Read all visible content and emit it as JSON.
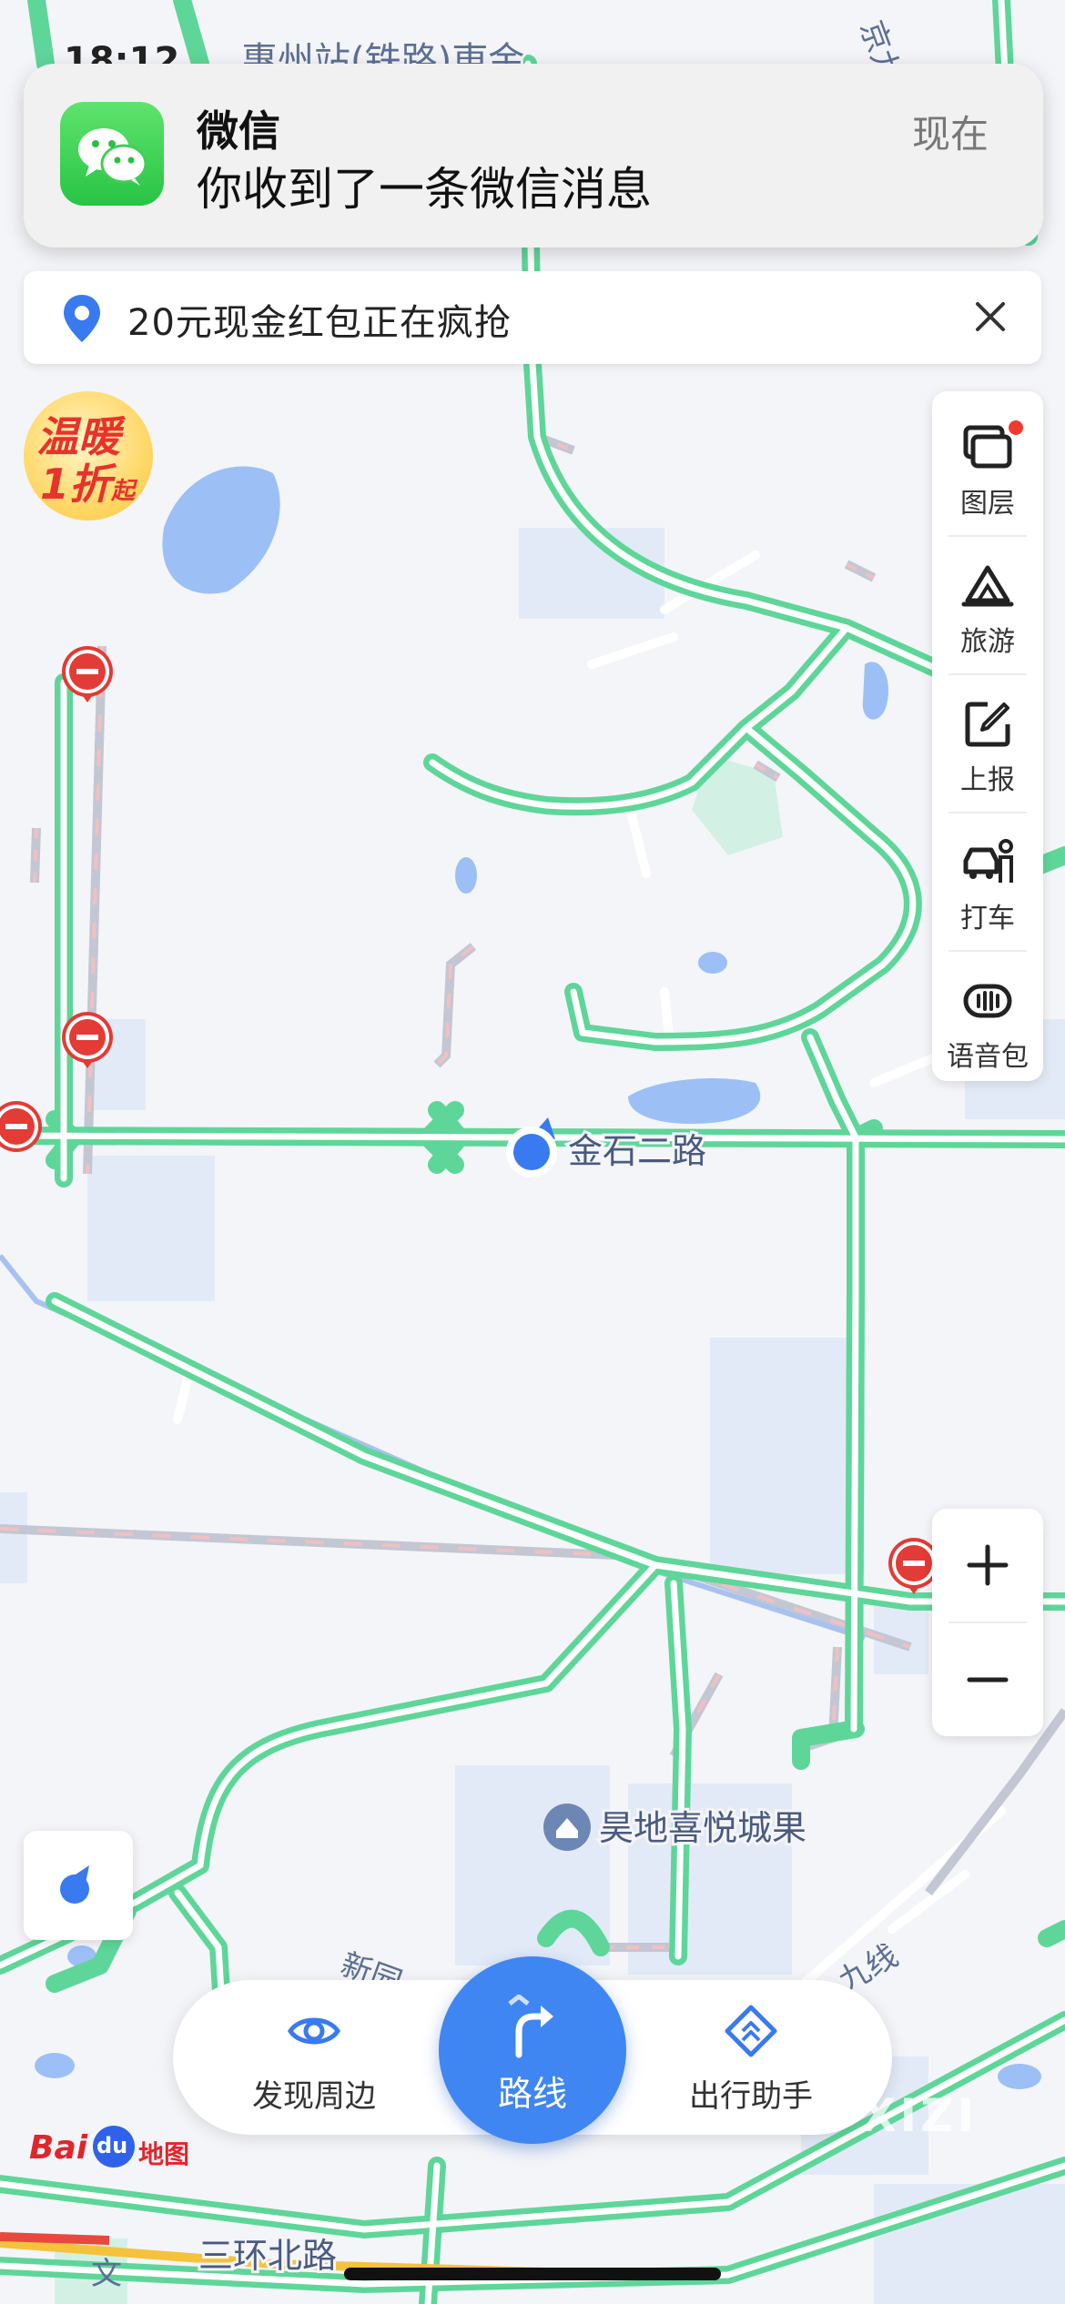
{
  "status_bar": {
    "time": "18:12"
  },
  "notification": {
    "app_name": "微信",
    "message": "你收到了一条微信消息",
    "time": "现在",
    "icon": "wechat-icon"
  },
  "promo_banner": {
    "text": "20元现金红包正在疯抢",
    "icon": "location-pin-icon",
    "close_icon": "close-icon"
  },
  "promo_badge": {
    "line1": "温暖",
    "line2": "1折",
    "suffix": "起"
  },
  "side_toolbar": {
    "items": [
      {
        "label": "图层",
        "icon": "layers-icon",
        "has_red_dot": true
      },
      {
        "label": "旅游",
        "icon": "travel-icon"
      },
      {
        "label": "上报",
        "icon": "report-icon"
      },
      {
        "label": "打车",
        "icon": "taxi-icon"
      },
      {
        "label": "语音包",
        "icon": "voice-pack-icon"
      }
    ]
  },
  "zoom": {
    "in_icon": "plus-icon",
    "out_icon": "minus-icon"
  },
  "map": {
    "labels": {
      "top_road": "惠州站(铁路)東金",
      "road_current": "金石二路",
      "poi_mall": "昊地喜悦城果",
      "road_bottom": "三环北路",
      "road_partial_left": "新园",
      "road_partial_right": "九线",
      "road_partial_corner": "文",
      "road_partial_top": "京九"
    },
    "colors": {
      "road_green": "#5ed699",
      "water_blue": "#9cc0f5",
      "block_blue": "#e3eaf7",
      "background": "#f4f5f8",
      "location_blue": "#3a7af0",
      "poi_blue": "#6d87b5"
    }
  },
  "locate_button": {
    "icon": "compass-icon"
  },
  "bottom_bar": {
    "discover_label": "发现周边",
    "discover_icon": "eye-icon",
    "route_label": "路线",
    "route_icon": "route-turn-icon",
    "assistant_label": "出行助手",
    "assistant_icon": "assistant-icon"
  },
  "logo": {
    "bai": "Bai",
    "du": "du",
    "ditu": "地图"
  },
  "watermark": "XIZI"
}
